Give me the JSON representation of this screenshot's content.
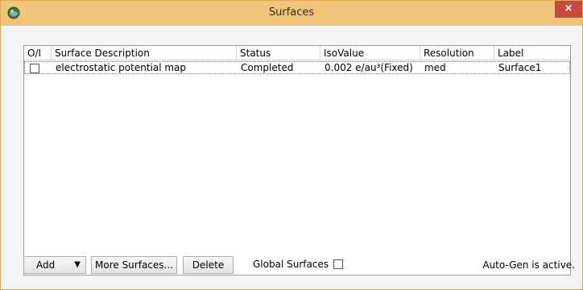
{
  "window": {
    "title": "Surfaces",
    "close_label": "×"
  },
  "table": {
    "columns": [
      "O/I",
      "Surface Description",
      "Status",
      "IsoValue",
      "Resolution",
      "Label"
    ],
    "rows": [
      {
        "checked": false,
        "description": "electrostatic potential map",
        "status": "Completed",
        "isovalue": "0.002 e/au³(Fixed)",
        "resolution": "med",
        "label": "Surface1"
      }
    ]
  },
  "buttons": {
    "add": "Add",
    "add_dropdown_icon": "▼",
    "more_surfaces": "More Surfaces...",
    "delete": "Delete"
  },
  "global_surfaces": {
    "label": "Global Surfaces",
    "checked": false
  },
  "status": {
    "text": "Auto-Gen is active."
  },
  "colors": {
    "titlebar": "#f2c47a",
    "close_button": "#c74a3e",
    "border": "#e2a954"
  }
}
